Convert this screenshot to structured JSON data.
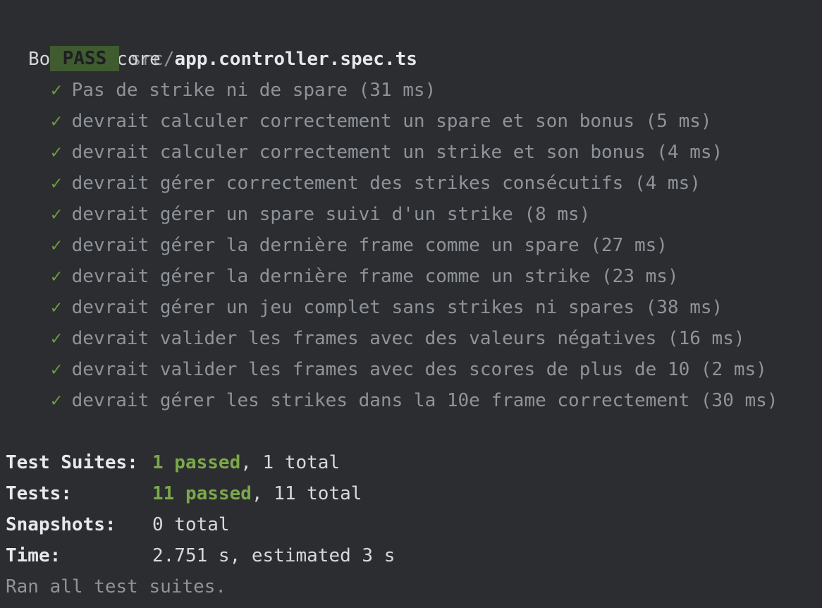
{
  "header": {
    "badge": "PASS",
    "path_dir": "src/",
    "path_file": "app.controller.spec.ts"
  },
  "suite": {
    "name": "BowlingScore",
    "check_glyph": "✓",
    "tests": [
      "Pas de strike ni de spare (31 ms)",
      "devrait calculer correctement un spare et son bonus (5 ms)",
      "devrait calculer correctement un strike et son bonus (4 ms)",
      "devrait gérer correctement des strikes consécutifs (4 ms)",
      "devrait gérer un spare suivi d'un strike (8 ms)",
      "devrait gérer la dernière frame comme un spare (27 ms)",
      "devrait gérer la dernière frame comme un strike (23 ms)",
      "devrait gérer un jeu complet sans strikes ni spares (38 ms)",
      "devrait valider les frames avec des valeurs négatives (16 ms)",
      "devrait valider les frames avec des scores de plus de 10 (2 ms)",
      "devrait gérer les strikes dans la 10e frame correctement (30 ms)"
    ]
  },
  "summary": {
    "suites_label": "Test Suites:",
    "suites_passed": "1 passed",
    "suites_total": ", 1 total",
    "tests_label": "Tests:",
    "tests_passed": "11 passed",
    "tests_total": ", 11 total",
    "snapshots_label": "Snapshots:",
    "snapshots_value": "0 total",
    "time_label": "Time:",
    "time_value": "2.751 s, estimated 3 s",
    "footer": "Ran all test suites."
  },
  "colors": {
    "background": "#2b2d30",
    "pass_badge": "#3f5b2f",
    "check_green": "#6f9a3f",
    "passed_green": "#7ca84a"
  }
}
